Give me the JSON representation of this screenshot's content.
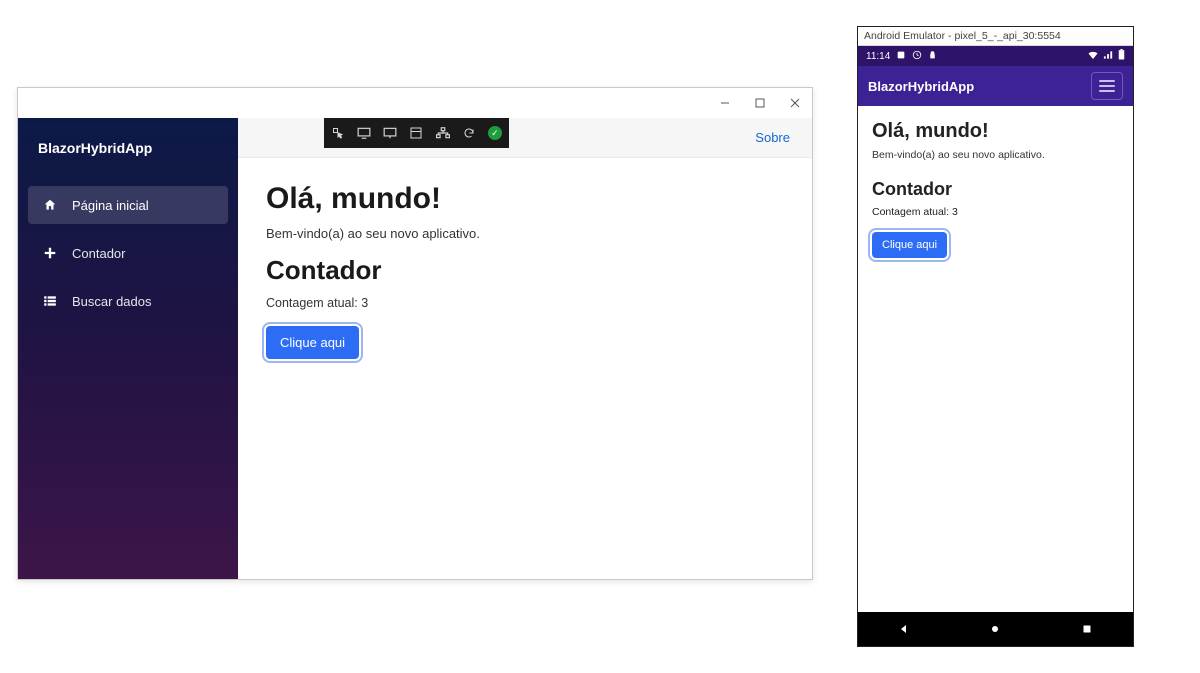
{
  "desktop": {
    "brand": "BlazorHybridApp",
    "nav": [
      {
        "label": "Página inicial",
        "icon": "home-icon",
        "active": true
      },
      {
        "label": "Contador",
        "icon": "plus-icon",
        "active": false
      },
      {
        "label": "Buscar dados",
        "icon": "list-icon",
        "active": false
      }
    ],
    "about_link": "Sobre",
    "hello_heading": "Olá, mundo!",
    "welcome_text": "Bem-vindo(a) ao seu novo aplicativo.",
    "counter_heading": "Contador",
    "counter_label": "Contagem atual:",
    "counter_value": 3,
    "button_label": "Clique aqui"
  },
  "mobile": {
    "emulator_caption": "Android Emulator - pixel_5_-_api_30:5554",
    "status_time": "11:14",
    "brand": "BlazorHybridApp",
    "hello_heading": "Olá, mundo!",
    "welcome_text": "Bem-vindo(a) ao seu novo aplicativo.",
    "counter_heading": "Contador",
    "counter_label": "Contagem atual:",
    "counter_value": 3,
    "button_label": "Clique aqui"
  }
}
